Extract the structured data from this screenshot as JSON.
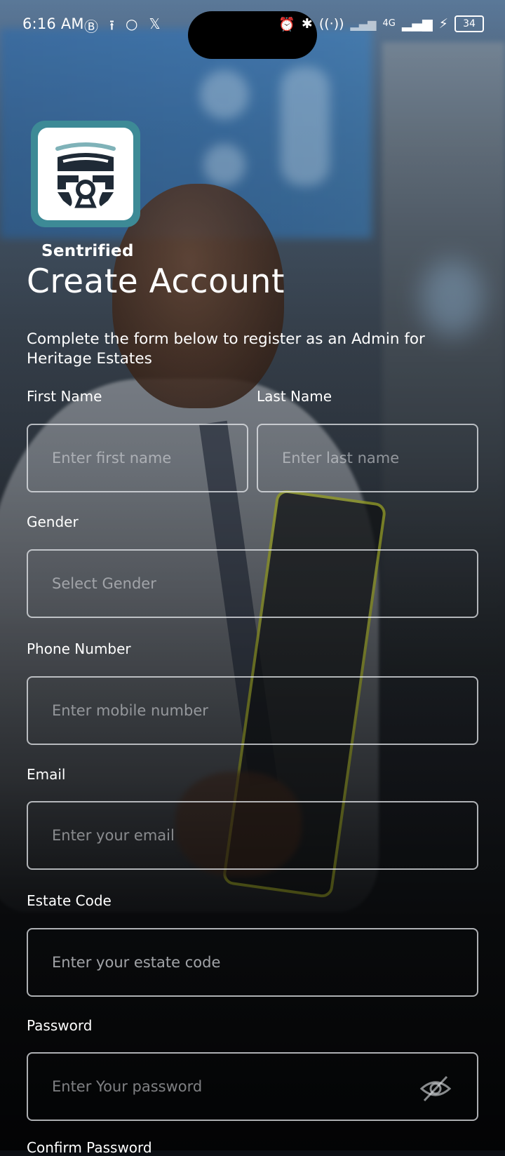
{
  "status_bar": {
    "time": "6:16 AM",
    "battery": "34",
    "network": "4G"
  },
  "app": {
    "brand": "Sentrified",
    "title": "Create Account",
    "subtitle": "Complete the form below to register as an Admin for Heritage Estates"
  },
  "form": {
    "first_name": {
      "label": "First Name",
      "placeholder": "Enter first name"
    },
    "last_name": {
      "label": "Last Name",
      "placeholder": "Enter last name"
    },
    "gender": {
      "label": "Gender",
      "placeholder": "Select Gender"
    },
    "phone": {
      "label": "Phone Number",
      "placeholder": "Enter mobile number"
    },
    "email": {
      "label": "Email",
      "placeholder": "Enter your email"
    },
    "estate_code": {
      "label": "Estate Code",
      "placeholder": "Enter your estate code"
    },
    "password": {
      "label": "Password",
      "placeholder": "Enter Your password"
    },
    "confirm_password": {
      "label": "Confirm Password"
    }
  },
  "colors": {
    "logo_frame": "#3d8a96",
    "logo_mark": "#1f2a36",
    "field_border": "#e6e8ec"
  },
  "icons": {
    "password_toggle": "eye-off-icon",
    "logo": "shield-lock-icon"
  }
}
